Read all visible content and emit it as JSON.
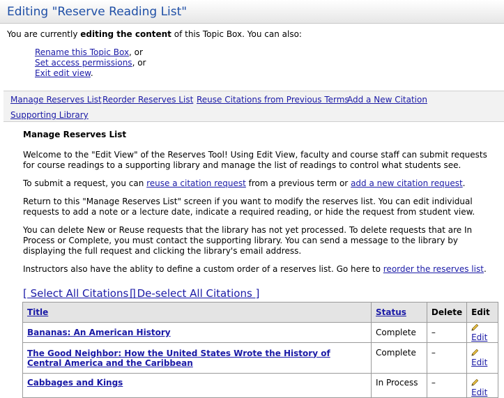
{
  "header": {
    "title": "Editing \"Reserve Reading List\""
  },
  "intro": {
    "pre": "You are currently ",
    "bold": "editing the content",
    "post": " of this Topic Box. You can also:"
  },
  "options": [
    {
      "label": "Rename this Topic Box",
      "suffix": ", or"
    },
    {
      "label": "Set access permissions",
      "suffix": ", or"
    },
    {
      "label": "Exit edit view",
      "suffix": "."
    }
  ],
  "tabs": [
    "Manage Reserves List",
    "Reorder Reserves List",
    "Reuse Citations from Previous Terms",
    "Add a New Citation",
    "Supporting Library"
  ],
  "content": {
    "heading": "Manage Reserves List",
    "p1": "Welcome to the \"Edit View\" of the Reserves Tool! Using Edit View, faculty and course staff can submit requests for course readings to a supporting library and manage the list of readings to control what students see.",
    "p2": {
      "a": "To submit a request, you can ",
      "link1": "reuse a citation request",
      "b": " from a previous term or ",
      "link2": "add a new citation request",
      "c": "."
    },
    "p3": "Return to this \"Manage Reserves List\" screen if you want to modify the reserves list. You can edit individual requests to add a note or a lecture date, indicate a required reading, or hide the request from student view.",
    "p4": "You can delete New or Reuse requests that the library has not yet processed. To delete requests that are In Process or Complete, you must contact the supporting library. You can send a message to the library by displaying the full request and clicking the library's email address.",
    "p5": {
      "a": "Instructors also have the ablity to define a custom order of a reserves list. Go here to ",
      "link": "reorder the reserves list",
      "b": "."
    }
  },
  "select_all": "[ Select All Citations ]",
  "deselect_all": "[ De-select All Citations ]",
  "table": {
    "headers": {
      "title": "Title",
      "status": "Status",
      "delete": "Delete",
      "edit": "Edit"
    },
    "rows": [
      {
        "title": "Bananas: An American History",
        "status": "Complete",
        "delete": "–",
        "edit": "Edit"
      },
      {
        "title": "The Good Neighbor: How the United States Wrote the History of Central America and the Caribbean",
        "status": "Complete",
        "delete": "–",
        "edit": "Edit"
      },
      {
        "title": "Cabbages and Kings",
        "status": "In Process",
        "delete": "–",
        "edit": "Edit"
      }
    ]
  },
  "colors": {
    "title_blue": "#1f4fa6",
    "link": "#1a1aa6"
  }
}
